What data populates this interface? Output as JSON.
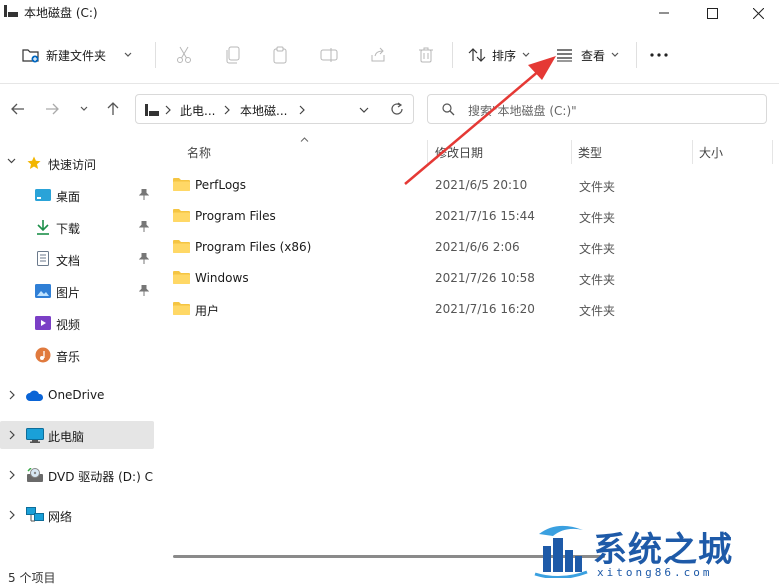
{
  "window": {
    "title": "本地磁盘 (C:)"
  },
  "toolbar": {
    "new_label": "新建文件夹",
    "sort_label": "排序",
    "view_label": "查看"
  },
  "address": {
    "crumbs": [
      "此电...",
      "本地磁..."
    ],
    "search_placeholder": "搜索\"本地磁盘 (C:)\""
  },
  "sidebar": {
    "quick_access": "快速访问",
    "pinned": [
      {
        "label": "桌面"
      },
      {
        "label": "下载"
      },
      {
        "label": "文档"
      },
      {
        "label": "图片"
      }
    ],
    "recent": [
      {
        "label": "视频"
      },
      {
        "label": "音乐"
      }
    ],
    "onedrive": "OneDrive",
    "this_pc": "此电脑",
    "dvd": "DVD 驱动器 (D:) CP",
    "network": "网络"
  },
  "columns": {
    "name": "名称",
    "date": "修改日期",
    "type": "类型",
    "size": "大小"
  },
  "files": [
    {
      "name": "PerfLogs",
      "date": "2021/6/5 20:10",
      "type": "文件夹"
    },
    {
      "name": "Program Files",
      "date": "2021/7/16 15:44",
      "type": "文件夹"
    },
    {
      "name": "Program Files (x86)",
      "date": "2021/6/6 2:06",
      "type": "文件夹"
    },
    {
      "name": "Windows",
      "date": "2021/7/26 10:58",
      "type": "文件夹"
    },
    {
      "name": "用户",
      "date": "2021/7/16 16:20",
      "type": "文件夹"
    }
  ],
  "status": {
    "count": "5 个项目"
  },
  "watermark": {
    "brand": "系统之城",
    "domain": "xitong86.com"
  },
  "colors": {
    "accent": "#0067c0",
    "folder": "#f5c542",
    "arrow": "#e53935",
    "selected": "#e5e5e5"
  }
}
